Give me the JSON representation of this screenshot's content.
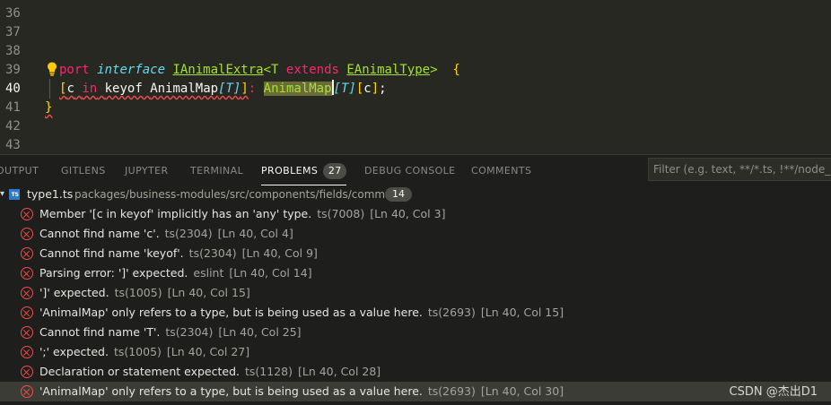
{
  "editor": {
    "line_numbers": [
      "36",
      "37",
      "38",
      "39",
      "40",
      "41",
      "42",
      "43"
    ],
    "active_line": "40",
    "line39": {
      "port": "port",
      "interface": "interface",
      "name": "IAnimalExtra",
      "lt": "<",
      "T": "T",
      "extends": "extends",
      "etype": "EAnimalType",
      "gt": ">",
      "brace": "{"
    },
    "line40": {
      "open": "[",
      "c": "c",
      "in": "in",
      "keyof": "keyof",
      "animalmap1": "AnimalMap",
      "bracket_T": "[T]",
      "close": "]",
      "colon": ":",
      "animalmap2": "AnimalMap",
      "idx_T": "[T]",
      "idx_c_open": "[",
      "idx_c": "c",
      "idx_c_close": "]",
      "semi": ";"
    },
    "line41": {
      "brace": "}"
    },
    "lightbulb_icon": "lightbulb-icon"
  },
  "panel": {
    "tabs": [
      {
        "label": "OUTPUT"
      },
      {
        "label": "GITLENS"
      },
      {
        "label": "JUPYTER"
      },
      {
        "label": "TERMINAL"
      },
      {
        "label": "PROBLEMS",
        "badge": "27"
      },
      {
        "label": "DEBUG CONSOLE"
      },
      {
        "label": "COMMENTS"
      }
    ],
    "active_tab": "PROBLEMS",
    "filter_placeholder": "Filter (e.g. text, **/*.ts, !**/node_modules/**)"
  },
  "problems": {
    "file": {
      "icon": "typescript-file-icon",
      "icon_text": "TS",
      "name": "type1.ts",
      "path": "packages/business-modules/src/components/fields/common",
      "count": "14"
    },
    "items": [
      {
        "message": "Member '[c in keyof' implicitly has an 'any' type.",
        "source": "ts(7008)",
        "position": "[Ln 40, Col 3]"
      },
      {
        "message": "Cannot find name 'c'.",
        "source": "ts(2304)",
        "position": "[Ln 40, Col 4]"
      },
      {
        "message": "Cannot find name 'keyof'.",
        "source": "ts(2304)",
        "position": "[Ln 40, Col 9]"
      },
      {
        "message": "Parsing error: ']' expected.",
        "source": "eslint",
        "position": "[Ln 40, Col 14]"
      },
      {
        "message": "']' expected.",
        "source": "ts(1005)",
        "position": "[Ln 40, Col 15]"
      },
      {
        "message": "'AnimalMap' only refers to a type, but is being used as a value here.",
        "source": "ts(2693)",
        "position": "[Ln 40, Col 15]"
      },
      {
        "message": "Cannot find name 'T'.",
        "source": "ts(2304)",
        "position": "[Ln 40, Col 25]"
      },
      {
        "message": "';' expected.",
        "source": "ts(1005)",
        "position": "[Ln 40, Col 27]"
      },
      {
        "message": "Declaration or statement expected.",
        "source": "ts(1128)",
        "position": "[Ln 40, Col 28]"
      },
      {
        "message": "'AnimalMap' only refers to a type, but is being used as a value here.",
        "source": "ts(2693)",
        "position": "[Ln 40, Col 30]"
      }
    ],
    "selected_index": 9
  },
  "watermark": "CSDN @杰出D1",
  "colors": {
    "error": "#f14c4c",
    "keyword": "#f92672",
    "type": "#a6e22e",
    "storage": "#66d9ef",
    "bracket": "#ffd700"
  }
}
